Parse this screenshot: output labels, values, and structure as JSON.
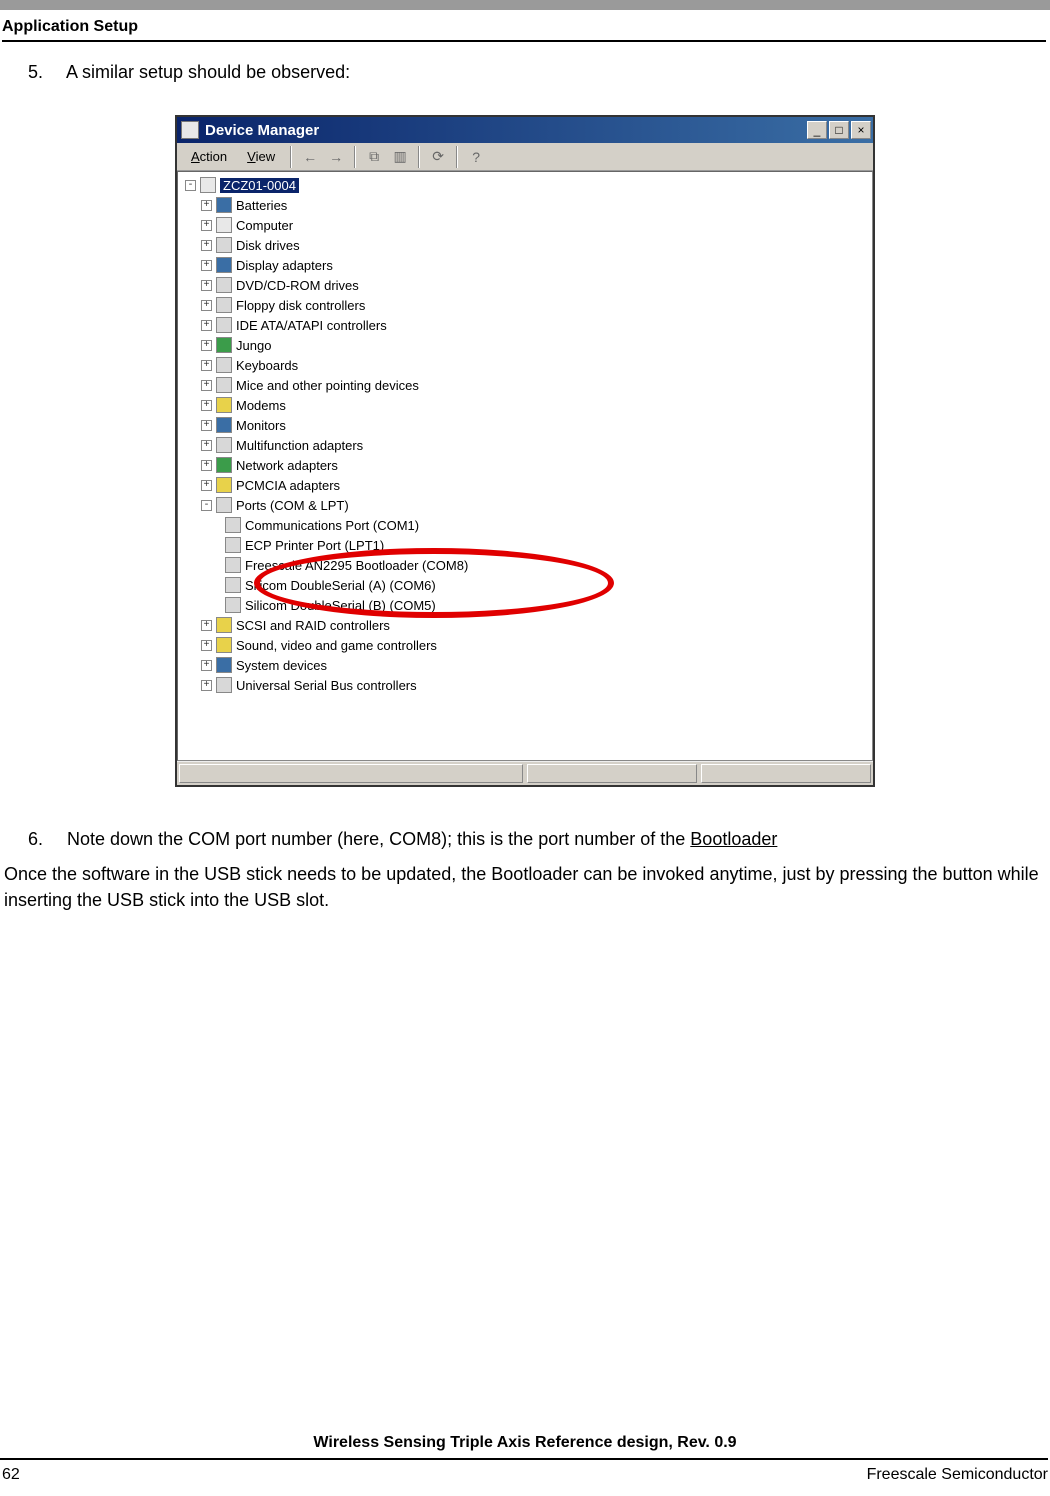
{
  "page": {
    "section_title": "Application Setup",
    "footer_title": "Wireless Sensing Triple Axis Reference design, Rev. 0.9",
    "page_number": "62",
    "footer_right": "Freescale Semiconductor"
  },
  "steps": {
    "s5_num": "5.",
    "s5_text": "A similar setup should be observed:",
    "s6_num": "6.",
    "s6_text_a": "Note down the COM port number (here, COM8); this is the port number of the ",
    "s6_text_b": "Bootloader"
  },
  "body_paragraph": "Once the software in the USB stick needs to be updated, the Bootloader can be invoked anytime, just by pressing the button while inserting the USB stick into the USB slot.",
  "devmgr": {
    "title": "Device Manager",
    "menu_action_u": "A",
    "menu_action_rest": "ction",
    "menu_view_u": "V",
    "menu_view_rest": "iew",
    "win_min": "_",
    "win_max": "□",
    "win_close": "×",
    "tool_back": "←",
    "tool_fwd": "→",
    "tool_props": "⧉",
    "tool_details": "▥",
    "tool_refresh": "⟳",
    "tool_help": "?",
    "root": "ZCZ01-0004",
    "nodes": {
      "batteries": "Batteries",
      "computer": "Computer",
      "disk": "Disk drives",
      "display": "Display adapters",
      "dvd": "DVD/CD-ROM drives",
      "floppy": "Floppy disk controllers",
      "ide": "IDE ATA/ATAPI controllers",
      "jungo": "Jungo",
      "keyboards": "Keyboards",
      "mice": "Mice and other pointing devices",
      "modems": "Modems",
      "monitors": "Monitors",
      "multi": "Multifunction adapters",
      "network": "Network adapters",
      "pcmcia": "PCMCIA adapters",
      "ports": "Ports (COM & LPT)",
      "port_com1": "Communications Port (COM1)",
      "port_lpt1": "ECP Printer Port (LPT1)",
      "port_boot": "Freescale AN2295 Bootloader (COM8)",
      "port_ds_a": "Silicom DoubleSerial (A) (COM6)",
      "port_ds_b": "Silicom DoubleSerial (B) (COM5)",
      "scsi": "SCSI and RAID controllers",
      "sound": "Sound, video and game controllers",
      "system": "System devices",
      "usb": "Universal Serial Bus controllers"
    }
  }
}
